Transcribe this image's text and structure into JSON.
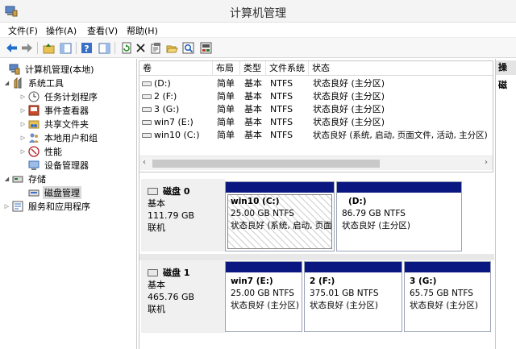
{
  "window": {
    "title": "计算机管理"
  },
  "menu": [
    "文件(F)",
    "操作(A)",
    "查看(V)",
    "帮助(H)"
  ],
  "toolbar": {
    "icons": [
      "back-arrow-icon",
      "forward-arrow-icon",
      "up-folder-icon",
      "show-tree-icon",
      "help-icon",
      "properties-icon",
      "refresh-icon",
      "delete-icon",
      "settings-icon",
      "open-icon",
      "search-icon",
      "disk-properties-icon"
    ]
  },
  "tree": {
    "root": "计算机管理(本地)",
    "system_tools": "系统工具",
    "task_scheduler": "任务计划程序",
    "event_viewer": "事件查看器",
    "shared_folders": "共享文件夹",
    "local_users": "本地用户和组",
    "performance": "性能",
    "device_manager": "设备管理器",
    "storage": "存储",
    "disk_management": "磁盘管理",
    "services": "服务和应用程序"
  },
  "volumes": {
    "columns": [
      "卷",
      "布局",
      "类型",
      "文件系统",
      "状态"
    ],
    "rows": [
      {
        "name": "(D:)",
        "layout": "简单",
        "type": "基本",
        "fs": "NTFS",
        "status": "状态良好 (主分区)"
      },
      {
        "name": "2 (F:)",
        "layout": "简单",
        "type": "基本",
        "fs": "NTFS",
        "status": "状态良好 (主分区)"
      },
      {
        "name": "3 (G:)",
        "layout": "简单",
        "type": "基本",
        "fs": "NTFS",
        "status": "状态良好 (主分区)"
      },
      {
        "name": "win7 (E:)",
        "layout": "简单",
        "type": "基本",
        "fs": "NTFS",
        "status": "状态良好 (主分区)"
      },
      {
        "name": "win10 (C:)",
        "layout": "简单",
        "type": "基本",
        "fs": "NTFS",
        "status": "状态良好 (系统, 启动, 页面文件, 活动, 主分区)"
      }
    ],
    "scroll_left": "‹",
    "scroll_right": "›"
  },
  "disks": [
    {
      "name": "磁盘 0",
      "type": "基本",
      "size": "111.79 GB",
      "state": "联机",
      "partitions": [
        {
          "name": "win10  (C:)",
          "size": "25.00 GB NTFS",
          "status": "状态良好 (系统, 启动, 页面"
        },
        {
          "name": "(D:)",
          "size": "86.79 GB NTFS",
          "status": "状态良好 (主分区)"
        }
      ]
    },
    {
      "name": "磁盘 1",
      "type": "基本",
      "size": "465.76 GB",
      "state": "联机",
      "partitions": [
        {
          "name": "win7  (E:)",
          "size": "25.00 GB NTFS",
          "status": "状态良好 (主分区)"
        },
        {
          "name": "2  (F:)",
          "size": "375.01 GB NTFS",
          "status": "状态良好 (主分区)"
        },
        {
          "name": "3  (G:)",
          "size": "65.75 GB NTFS",
          "status": "状态良好 (主分区)"
        }
      ]
    }
  ],
  "actions_pane": {
    "header": "操",
    "sub": "磁"
  },
  "colors": {
    "partition_bar": "#0b1780",
    "selected_row": "#d9d9d9"
  }
}
